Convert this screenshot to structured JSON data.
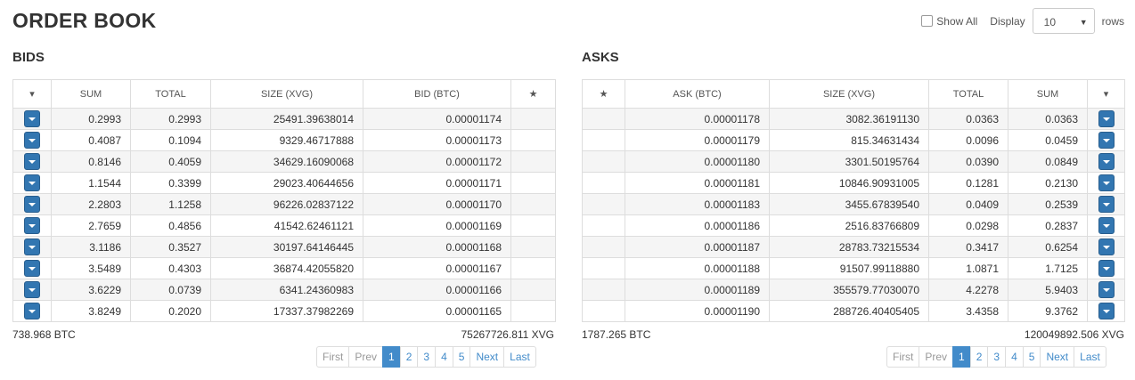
{
  "page": {
    "title": "ORDER BOOK"
  },
  "controls": {
    "show_all_label": "Show All",
    "display_label": "Display",
    "rows_value": "10",
    "rows_label": "rows"
  },
  "bids": {
    "title": "BIDS",
    "headers": {
      "menu": "▾",
      "sum": "SUM",
      "total": "TOTAL",
      "size": "SIZE (XVG)",
      "price": "BID (BTC)",
      "star": "★"
    },
    "rows": [
      {
        "sum": "0.2993",
        "total": "0.2993",
        "size": "25491.39638014",
        "price": "0.00001174"
      },
      {
        "sum": "0.4087",
        "total": "0.1094",
        "size": "9329.46717888",
        "price": "0.00001173"
      },
      {
        "sum": "0.8146",
        "total": "0.4059",
        "size": "34629.16090068",
        "price": "0.00001172"
      },
      {
        "sum": "1.1544",
        "total": "0.3399",
        "size": "29023.40644656",
        "price": "0.00001171"
      },
      {
        "sum": "2.2803",
        "total": "1.1258",
        "size": "96226.02837122",
        "price": "0.00001170"
      },
      {
        "sum": "2.7659",
        "total": "0.4856",
        "size": "41542.62461121",
        "price": "0.00001169"
      },
      {
        "sum": "3.1186",
        "total": "0.3527",
        "size": "30197.64146445",
        "price": "0.00001168"
      },
      {
        "sum": "3.5489",
        "total": "0.4303",
        "size": "36874.42055820",
        "price": "0.00001167"
      },
      {
        "sum": "3.6229",
        "total": "0.0739",
        "size": "6341.24360983",
        "price": "0.00001166"
      },
      {
        "sum": "3.8249",
        "total": "0.2020",
        "size": "17337.37982269",
        "price": "0.00001165"
      }
    ],
    "footer": {
      "btc": "738.968 BTC",
      "xvg": "75267726.811 XVG"
    },
    "pager": [
      "First",
      "Prev",
      "1",
      "2",
      "3",
      "4",
      "5",
      "Next",
      "Last"
    ]
  },
  "asks": {
    "title": "ASKS",
    "headers": {
      "star": "★",
      "price": "ASK (BTC)",
      "size": "SIZE (XVG)",
      "total": "TOTAL",
      "sum": "SUM",
      "menu": "▾"
    },
    "rows": [
      {
        "price": "0.00001178",
        "size": "3082.36191130",
        "total": "0.0363",
        "sum": "0.0363"
      },
      {
        "price": "0.00001179",
        "size": "815.34631434",
        "total": "0.0096",
        "sum": "0.0459"
      },
      {
        "price": "0.00001180",
        "size": "3301.50195764",
        "total": "0.0390",
        "sum": "0.0849"
      },
      {
        "price": "0.00001181",
        "size": "10846.90931005",
        "total": "0.1281",
        "sum": "0.2130"
      },
      {
        "price": "0.00001183",
        "size": "3455.67839540",
        "total": "0.0409",
        "sum": "0.2539"
      },
      {
        "price": "0.00001186",
        "size": "2516.83766809",
        "total": "0.0298",
        "sum": "0.2837"
      },
      {
        "price": "0.00001187",
        "size": "28783.73215534",
        "total": "0.3417",
        "sum": "0.6254"
      },
      {
        "price": "0.00001188",
        "size": "91507.99118880",
        "total": "1.0871",
        "sum": "1.7125"
      },
      {
        "price": "0.00001189",
        "size": "355579.77030070",
        "total": "4.2278",
        "sum": "5.9403"
      },
      {
        "price": "0.00001190",
        "size": "288726.40405405",
        "total": "3.4358",
        "sum": "9.3762"
      }
    ],
    "footer": {
      "btc": "1787.265 BTC",
      "xvg": "120049892.506 XVG"
    },
    "pager": [
      "First",
      "Prev",
      "1",
      "2",
      "3",
      "4",
      "5",
      "Next",
      "Last"
    ]
  },
  "pagination": {
    "active_page": "1"
  },
  "colors": {
    "accent": "#428bca",
    "row_button": "#3276b1",
    "stripe": "#f5f5f5",
    "border": "#dddddd"
  }
}
